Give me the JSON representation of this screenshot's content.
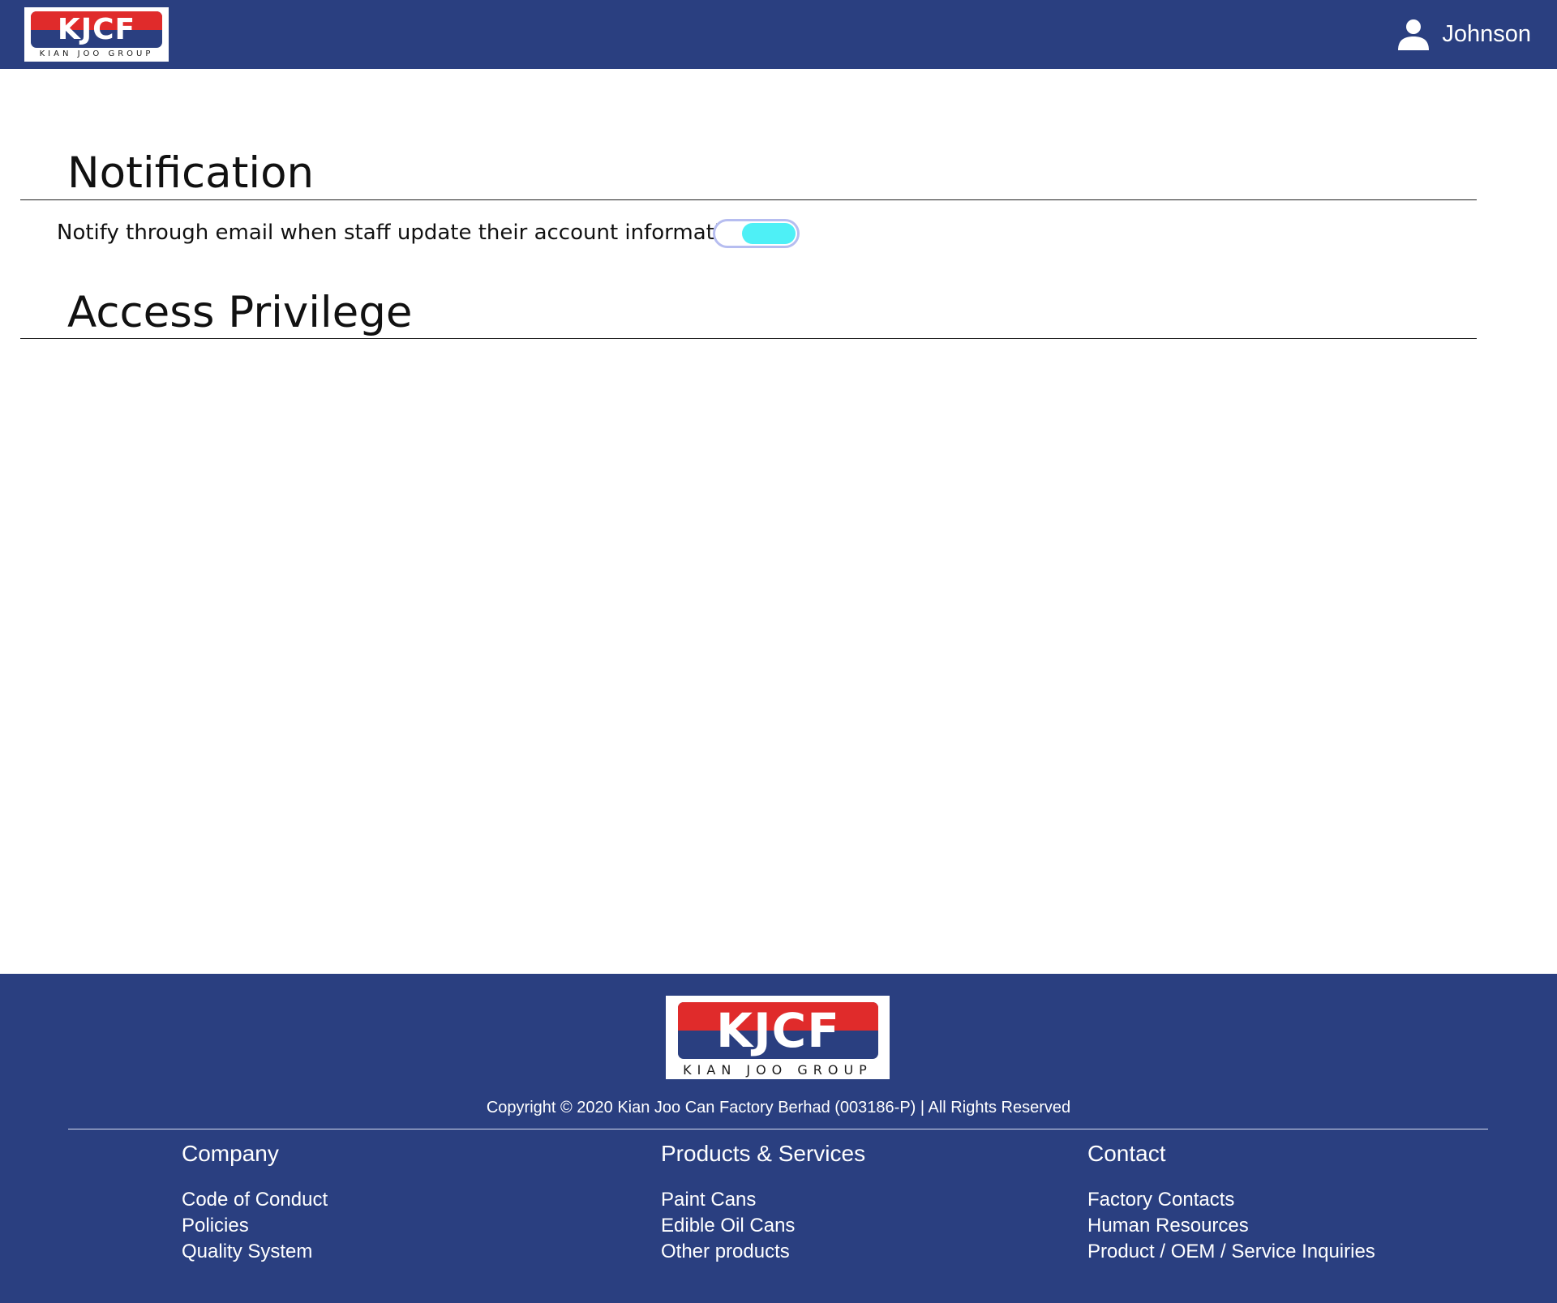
{
  "header": {
    "logo": {
      "text": "KJCF",
      "subtext": "KIAN JOO GROUP"
    },
    "user": {
      "name": "Johnson",
      "icon": "user-icon"
    }
  },
  "notification": {
    "title": "Notification",
    "email_setting": {
      "label": "Notify through email when staff update their account information",
      "enabled": true
    }
  },
  "access_privilege": {
    "title": "Access Privilege"
  },
  "footer": {
    "logo": {
      "text": "KJCF",
      "subtext": "KIAN JOO GROUP"
    },
    "copyright": "Copyright © 2020 Kian Joo Can Factory Berhad (003186-P) | All Rights Reserved",
    "columns": [
      {
        "heading": "Company",
        "links": [
          "Code of Conduct",
          "Policies",
          "Quality System"
        ]
      },
      {
        "heading": "Products & Services",
        "links": [
          "Paint Cans",
          "Edible Oil Cans",
          "Other products"
        ]
      },
      {
        "heading": "Contact",
        "links": [
          "Factory Contacts",
          "Human Resources",
          "Product / OEM / Service Inquiries"
        ]
      }
    ]
  },
  "colors": {
    "brand_navy": "#2a3f80",
    "brand_red": "#e02b2b",
    "toggle_on": "#4ef0f6",
    "toggle_border": "#b6bdf0"
  }
}
